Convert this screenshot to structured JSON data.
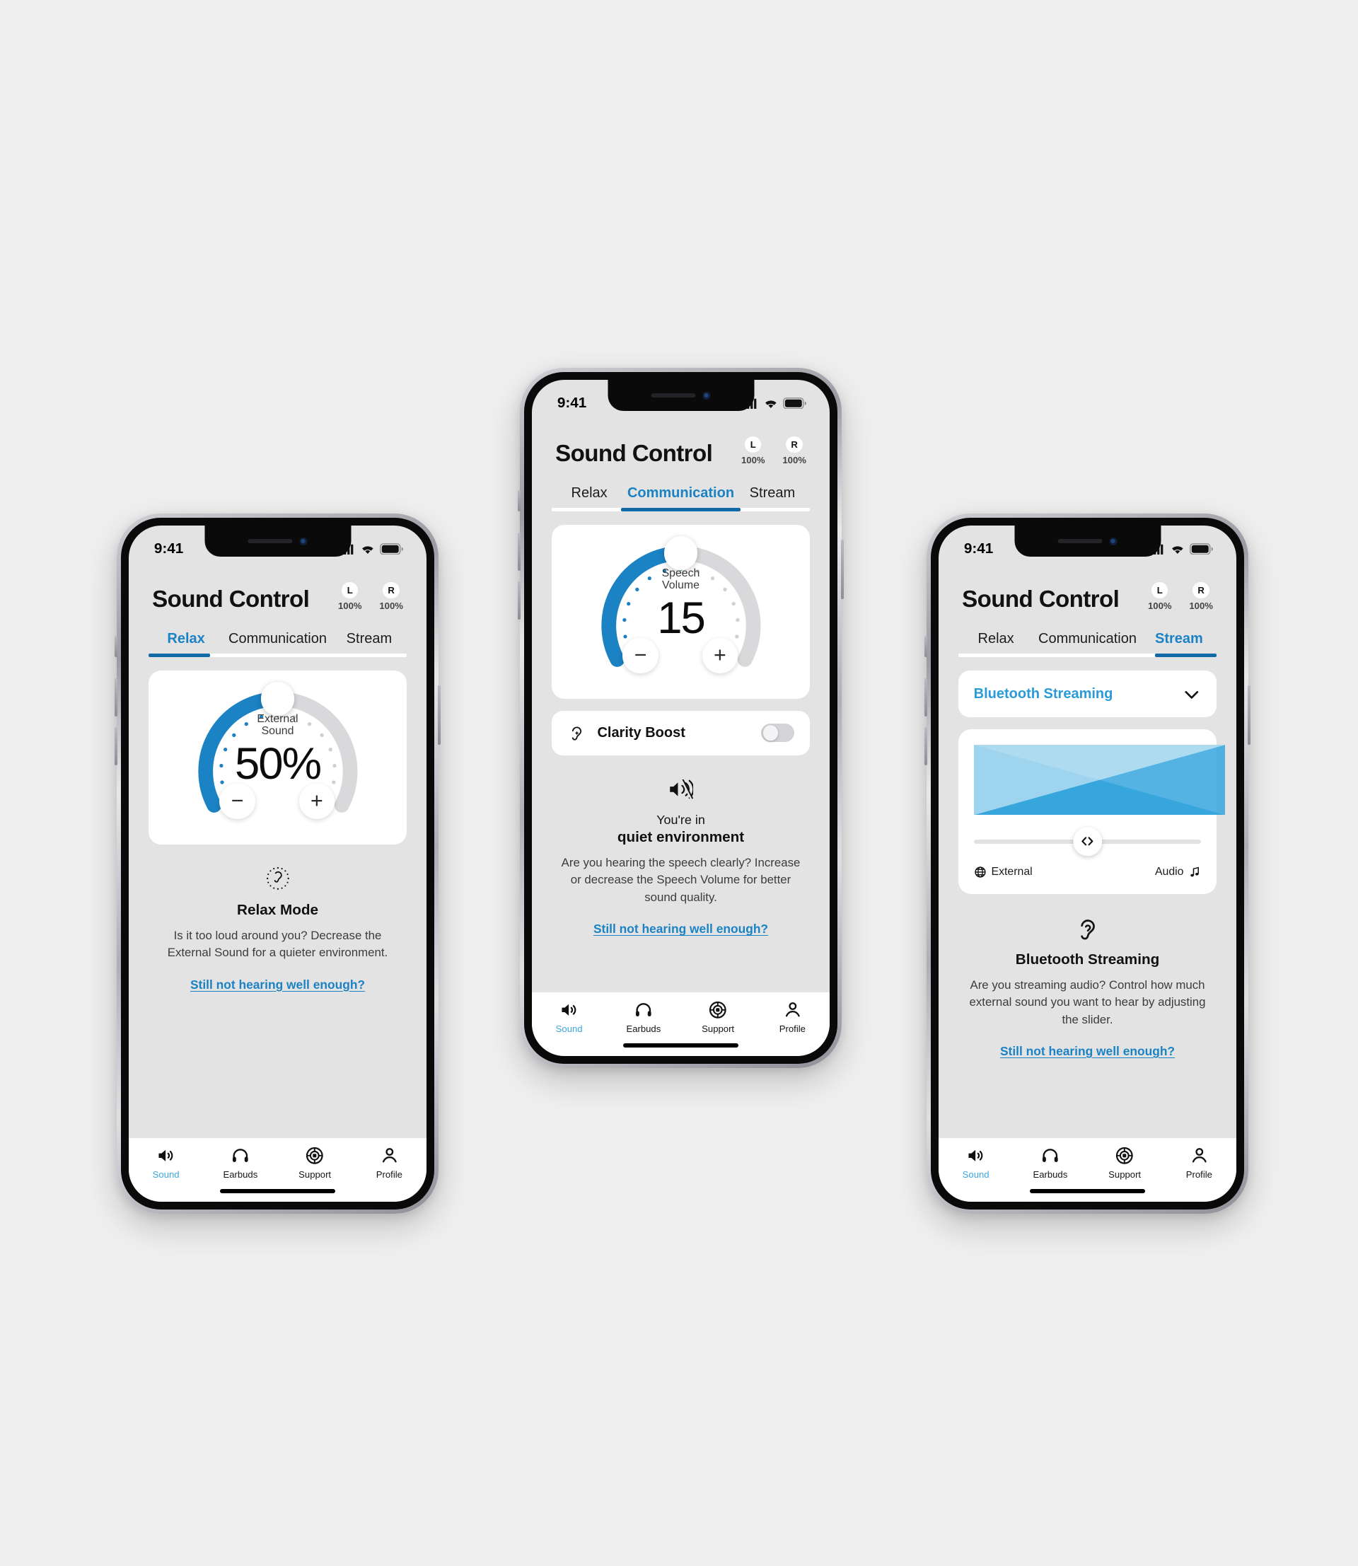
{
  "background_color": "#efefef",
  "accent_color": "#1b82c4",
  "accent_dark": "#1169a8",
  "arc_track_color": "#d9d9db",
  "screens": [
    {
      "id": "relax",
      "status": {
        "time": "9:41",
        "cellular_icon": "signal-bars-icon",
        "wifi_icon": "wifi-icon",
        "battery_icon": "battery-full-icon"
      },
      "header": {
        "title": "Sound Control",
        "pods": [
          {
            "side": "L",
            "percent": "100%"
          },
          {
            "side": "R",
            "percent": "100%"
          }
        ]
      },
      "tabs": [
        {
          "label": "Relax",
          "active": true
        },
        {
          "label": "Communication",
          "active": false
        },
        {
          "label": "Stream",
          "active": false
        }
      ],
      "dial": {
        "label_line1": "External",
        "label_line2": "Sound",
        "value": "50%",
        "percent": 50,
        "decrease_label": "−",
        "increase_label": "+"
      },
      "info": {
        "icon": "ear-relax-icon",
        "title": "Relax Mode",
        "subtitle": "",
        "description": "Is it too loud around you? Decrease the External Sound for a quieter environment.",
        "link": "Still not hearing well enough?"
      },
      "tabbar": [
        {
          "label": "Sound",
          "icon": "speaker-icon",
          "active": true
        },
        {
          "label": "Earbuds",
          "icon": "headphones-icon",
          "active": false
        },
        {
          "label": "Support",
          "icon": "lifebuoy-icon",
          "active": false
        },
        {
          "label": "Profile",
          "icon": "person-icon",
          "active": false
        }
      ]
    },
    {
      "id": "communication",
      "status": {
        "time": "9:41",
        "cellular_icon": "signal-bars-icon",
        "wifi_icon": "wifi-icon",
        "battery_icon": "battery-full-icon"
      },
      "header": {
        "title": "Sound Control",
        "pods": [
          {
            "side": "L",
            "percent": "100%"
          },
          {
            "side": "R",
            "percent": "100%"
          }
        ]
      },
      "tabs": [
        {
          "label": "Relax",
          "active": false
        },
        {
          "label": "Communication",
          "active": true
        },
        {
          "label": "Stream",
          "active": false
        }
      ],
      "dial": {
        "label_line1": "Speech",
        "label_line2": "Volume",
        "value": "15",
        "percent": 50,
        "decrease_label": "−",
        "increase_label": "+"
      },
      "toggle_row": {
        "icon": "ear-clarity-icon",
        "label": "Clarity Boost",
        "state": "off"
      },
      "info": {
        "icon": "sound-waves-icon",
        "title": "quiet environment",
        "subtitle": "You're in",
        "description": "Are you hearing the speech clearly? Increase or decrease the Speech Volume for better sound quality.",
        "link": "Still not hearing well enough?"
      },
      "tabbar": [
        {
          "label": "Sound",
          "icon": "speaker-icon",
          "active": true
        },
        {
          "label": "Earbuds",
          "icon": "headphones-icon",
          "active": false
        },
        {
          "label": "Support",
          "icon": "lifebuoy-icon",
          "active": false
        },
        {
          "label": "Profile",
          "icon": "person-icon",
          "active": false
        }
      ]
    },
    {
      "id": "stream",
      "status": {
        "time": "9:41",
        "cellular_icon": "signal-bars-icon",
        "wifi_icon": "wifi-icon",
        "battery_icon": "battery-full-icon"
      },
      "header": {
        "title": "Sound Control",
        "pods": [
          {
            "side": "L",
            "percent": "100%"
          },
          {
            "side": "R",
            "percent": "100%"
          }
        ]
      },
      "tabs": [
        {
          "label": "Relax",
          "active": false
        },
        {
          "label": "Communication",
          "active": false
        },
        {
          "label": "Stream",
          "active": true
        }
      ],
      "dropdown": {
        "value": "Bluetooth Streaming",
        "chevron_icon": "chevron-down-icon"
      },
      "mixer": {
        "slider_position_percent": 50,
        "handle_icon": "left-right-arrows-icon",
        "left_label": "External",
        "left_icon": "globe-icon",
        "right_label": "Audio",
        "right_icon": "music-note-icon",
        "external_color": "#a8d8f0",
        "audio_color": "#36a6dd"
      },
      "info": {
        "icon": "ear-icon",
        "title": "Bluetooth Streaming",
        "subtitle": "",
        "description": "Are you streaming audio? Control how much external sound you want to hear by adjusting the slider.",
        "link": "Still not hearing well enough?"
      },
      "tabbar": [
        {
          "label": "Sound",
          "icon": "speaker-icon",
          "active": true
        },
        {
          "label": "Earbuds",
          "icon": "headphones-icon",
          "active": false
        },
        {
          "label": "Support",
          "icon": "lifebuoy-icon",
          "active": false
        },
        {
          "label": "Profile",
          "icon": "person-icon",
          "active": false
        }
      ]
    }
  ]
}
